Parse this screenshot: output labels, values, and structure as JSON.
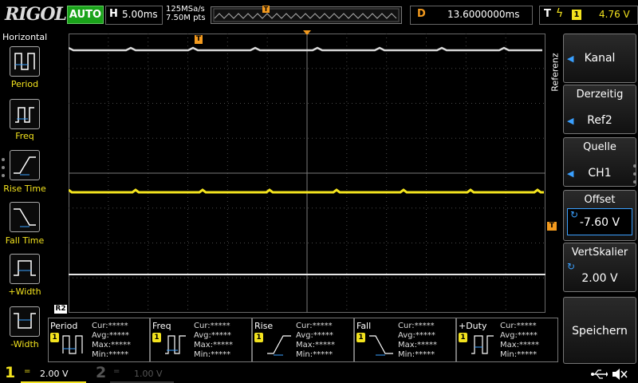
{
  "topbar": {
    "logo": "RIGOL",
    "auto_label": "AUTO",
    "h_label": "H",
    "h_value": "5.00ms",
    "sample_rate": "125MSa/s",
    "mem_depth": "7.50M pts",
    "trigger_marker": "T",
    "d_label": "D",
    "d_value": "13.6000000ms",
    "t_label": "T",
    "t_source": "1",
    "t_level": "4.76 V"
  },
  "left_menu": {
    "title": "Horizontal",
    "items": [
      {
        "label": "Period",
        "icon": "period-icon"
      },
      {
        "label": "Freq",
        "icon": "freq-icon"
      },
      {
        "label": "Rise Time",
        "icon": "rise-time-icon"
      },
      {
        "label": "Fall Time",
        "icon": "fall-time-icon"
      },
      {
        "label": "+Width",
        "icon": "pos-width-icon"
      },
      {
        "label": "-Width",
        "icon": "neg-width-icon"
      }
    ]
  },
  "right_menu": {
    "tab_label": "Referenz",
    "kanal": "Kanal",
    "derzeitig_title": "Derzeitig",
    "derzeitig_value": "Ref2",
    "quelle_title": "Quelle",
    "quelle_value": "CH1",
    "offset_title": "Offset",
    "offset_value": "-7.60 V",
    "vertskalier_title": "VertSkalier",
    "vertskalier_value": "2.00 V",
    "speichern": "Speichern"
  },
  "grid": {
    "ref_label": "R2",
    "trigger_top": "T",
    "offset_marker": "T",
    "colors": {
      "ch1": "#f3e31e",
      "ref": "#d8d8d8",
      "grid": "#5a5a5a",
      "trigger": "#f39a1e"
    }
  },
  "measurements": [
    {
      "name": "Period",
      "ch": "1",
      "cur": "Cur:*****",
      "avg": "Avg:*****",
      "max": "Max:*****",
      "min": "Min:*****"
    },
    {
      "name": "Freq",
      "ch": "1",
      "cur": "Cur:*****",
      "avg": "Avg:*****",
      "max": "Max:*****",
      "min": "Min:*****"
    },
    {
      "name": "Rise",
      "ch": "1",
      "cur": "Cur:*****",
      "avg": "Avg:*****",
      "max": "Max:*****",
      "min": "Min:*****"
    },
    {
      "name": "Fall",
      "ch": "1",
      "cur": "Cur:*****",
      "avg": "Avg:*****",
      "max": "Max:*****",
      "min": "Min:*****"
    },
    {
      "name": "+Duty",
      "ch": "1",
      "cur": "Cur:*****",
      "avg": "Avg:*****",
      "max": "Max:*****",
      "min": "Min:*****"
    }
  ],
  "bottombar": {
    "ch1_num": "1",
    "ch1_coupling": "=",
    "ch1_scale": "2.00 V",
    "ch2_num": "2",
    "ch2_coupling": "=",
    "ch2_scale": "1.00 V",
    "usb_icon": "usb-icon",
    "mute_icon": "speaker-mute-icon"
  }
}
